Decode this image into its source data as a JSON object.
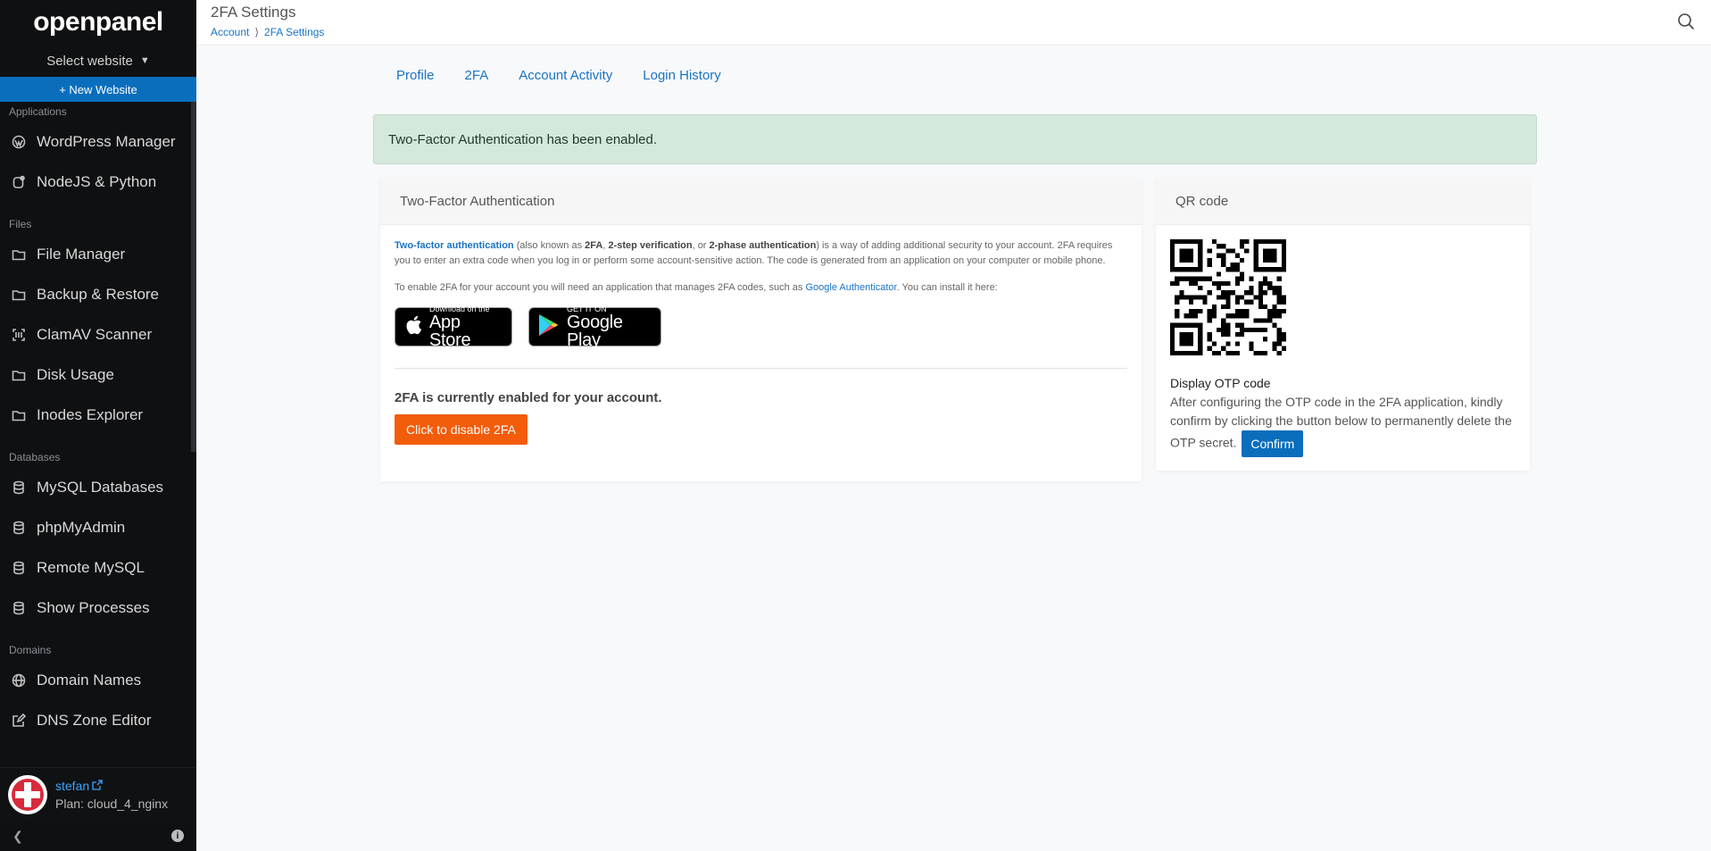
{
  "sidebar": {
    "logo": "openpanel",
    "select_website": "Select website",
    "new_website": "+ New Website",
    "sections": [
      {
        "label": "Applications",
        "items": [
          {
            "label": "WordPress Manager",
            "icon": "wordpress-icon"
          },
          {
            "label": "NodeJS & Python",
            "icon": "nodejs-icon"
          }
        ]
      },
      {
        "label": "Files",
        "items": [
          {
            "label": "File Manager",
            "icon": "folder-icon"
          },
          {
            "label": "Backup & Restore",
            "icon": "folder-icon"
          },
          {
            "label": "ClamAV Scanner",
            "icon": "scanner-icon"
          },
          {
            "label": "Disk Usage",
            "icon": "folder-icon"
          },
          {
            "label": "Inodes Explorer",
            "icon": "folder-icon"
          }
        ]
      },
      {
        "label": "Databases",
        "items": [
          {
            "label": "MySQL Databases",
            "icon": "database-icon"
          },
          {
            "label": "phpMyAdmin",
            "icon": "database-icon"
          },
          {
            "label": "Remote MySQL",
            "icon": "database-icon"
          },
          {
            "label": "Show Processes",
            "icon": "database-icon"
          }
        ]
      },
      {
        "label": "Domains",
        "items": [
          {
            "label": "Domain Names",
            "icon": "globe-icon"
          },
          {
            "label": "DNS Zone Editor",
            "icon": "edit-icon"
          }
        ]
      }
    ],
    "user": {
      "name": "stefan",
      "plan": "Plan: cloud_4_nginx"
    }
  },
  "header": {
    "title": "2FA Settings",
    "breadcrumb": [
      {
        "label": "Account"
      },
      {
        "label": "2FA Settings"
      }
    ]
  },
  "tabs": [
    {
      "label": "Profile"
    },
    {
      "label": "2FA"
    },
    {
      "label": "Account Activity"
    },
    {
      "label": "Login History"
    }
  ],
  "alert": {
    "text": "Two-Factor Authentication has been enabled.",
    "color": "#d4e8dc"
  },
  "twofa_card": {
    "title": "Two-Factor Authentication",
    "intro": {
      "link": "Two-factor authentication",
      "t1": " (also known as ",
      "b1": "2FA",
      "t2": ", ",
      "b2": "2-step verification",
      "t3": ", or ",
      "b3": "2-phase authentication",
      "t4": ") is a way of adding additional security to your account. 2FA requires you to enter an extra code when you log in or perform some account-sensitive action. The code is generated from an application on your computer or mobile phone."
    },
    "install": {
      "t1": "To enable 2FA for your account you will need an application that manages 2FA codes, such as ",
      "link": "Google Authenticator",
      "t2": ". You can install it here:"
    },
    "app_store": {
      "small": "Download on the",
      "big": "App Store"
    },
    "google_play": {
      "small": "GET IT ON",
      "big": "Google Play"
    },
    "status": "2FA is currently enabled for your account.",
    "disable_button": "Click to disable 2FA",
    "disable_color": "#f25c0a"
  },
  "qr_card": {
    "title": "QR code",
    "otp_title": "Display OTP code",
    "otp_text": "After configuring the OTP code in the 2FA application, kindly confirm by clicking the button below to permanently delete the OTP secret.",
    "confirm_button": "Confirm",
    "confirm_color": "#0a6ebd"
  }
}
